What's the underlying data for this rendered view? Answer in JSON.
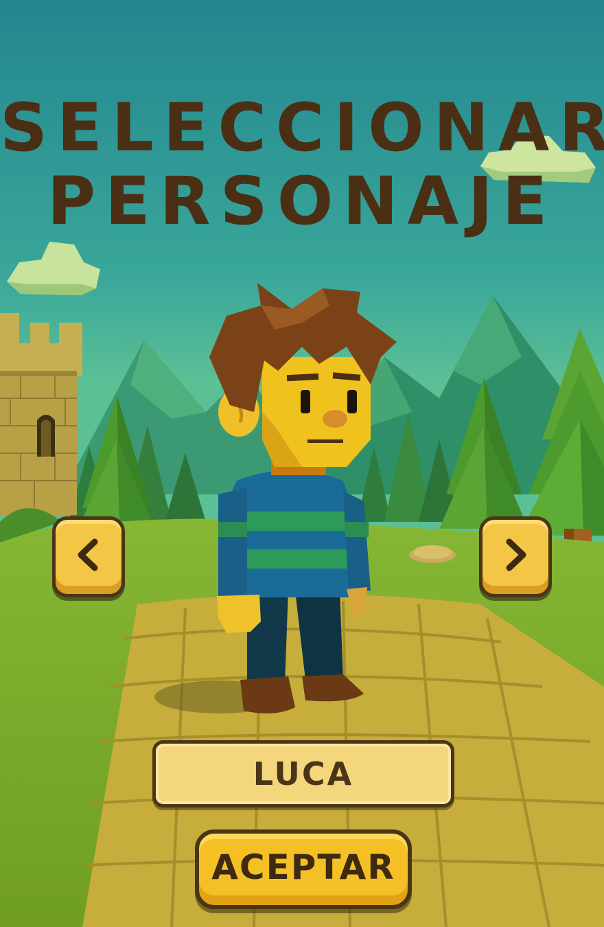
{
  "screen": {
    "title_line_1": "SELECCIONAR",
    "title_line_2": "PERSONAJE"
  },
  "character": {
    "name": "LUCA"
  },
  "navigation": {
    "prev_icon": "chevron-left-icon",
    "next_icon": "chevron-right-icon"
  },
  "actions": {
    "accept_label": "ACEPTAR"
  },
  "colors": {
    "sky_top": "#23878f",
    "title_text": "#4a2f14",
    "button_yellow": "#f5c025",
    "button_outline": "#4a3516",
    "grass": "#7fb02c"
  }
}
